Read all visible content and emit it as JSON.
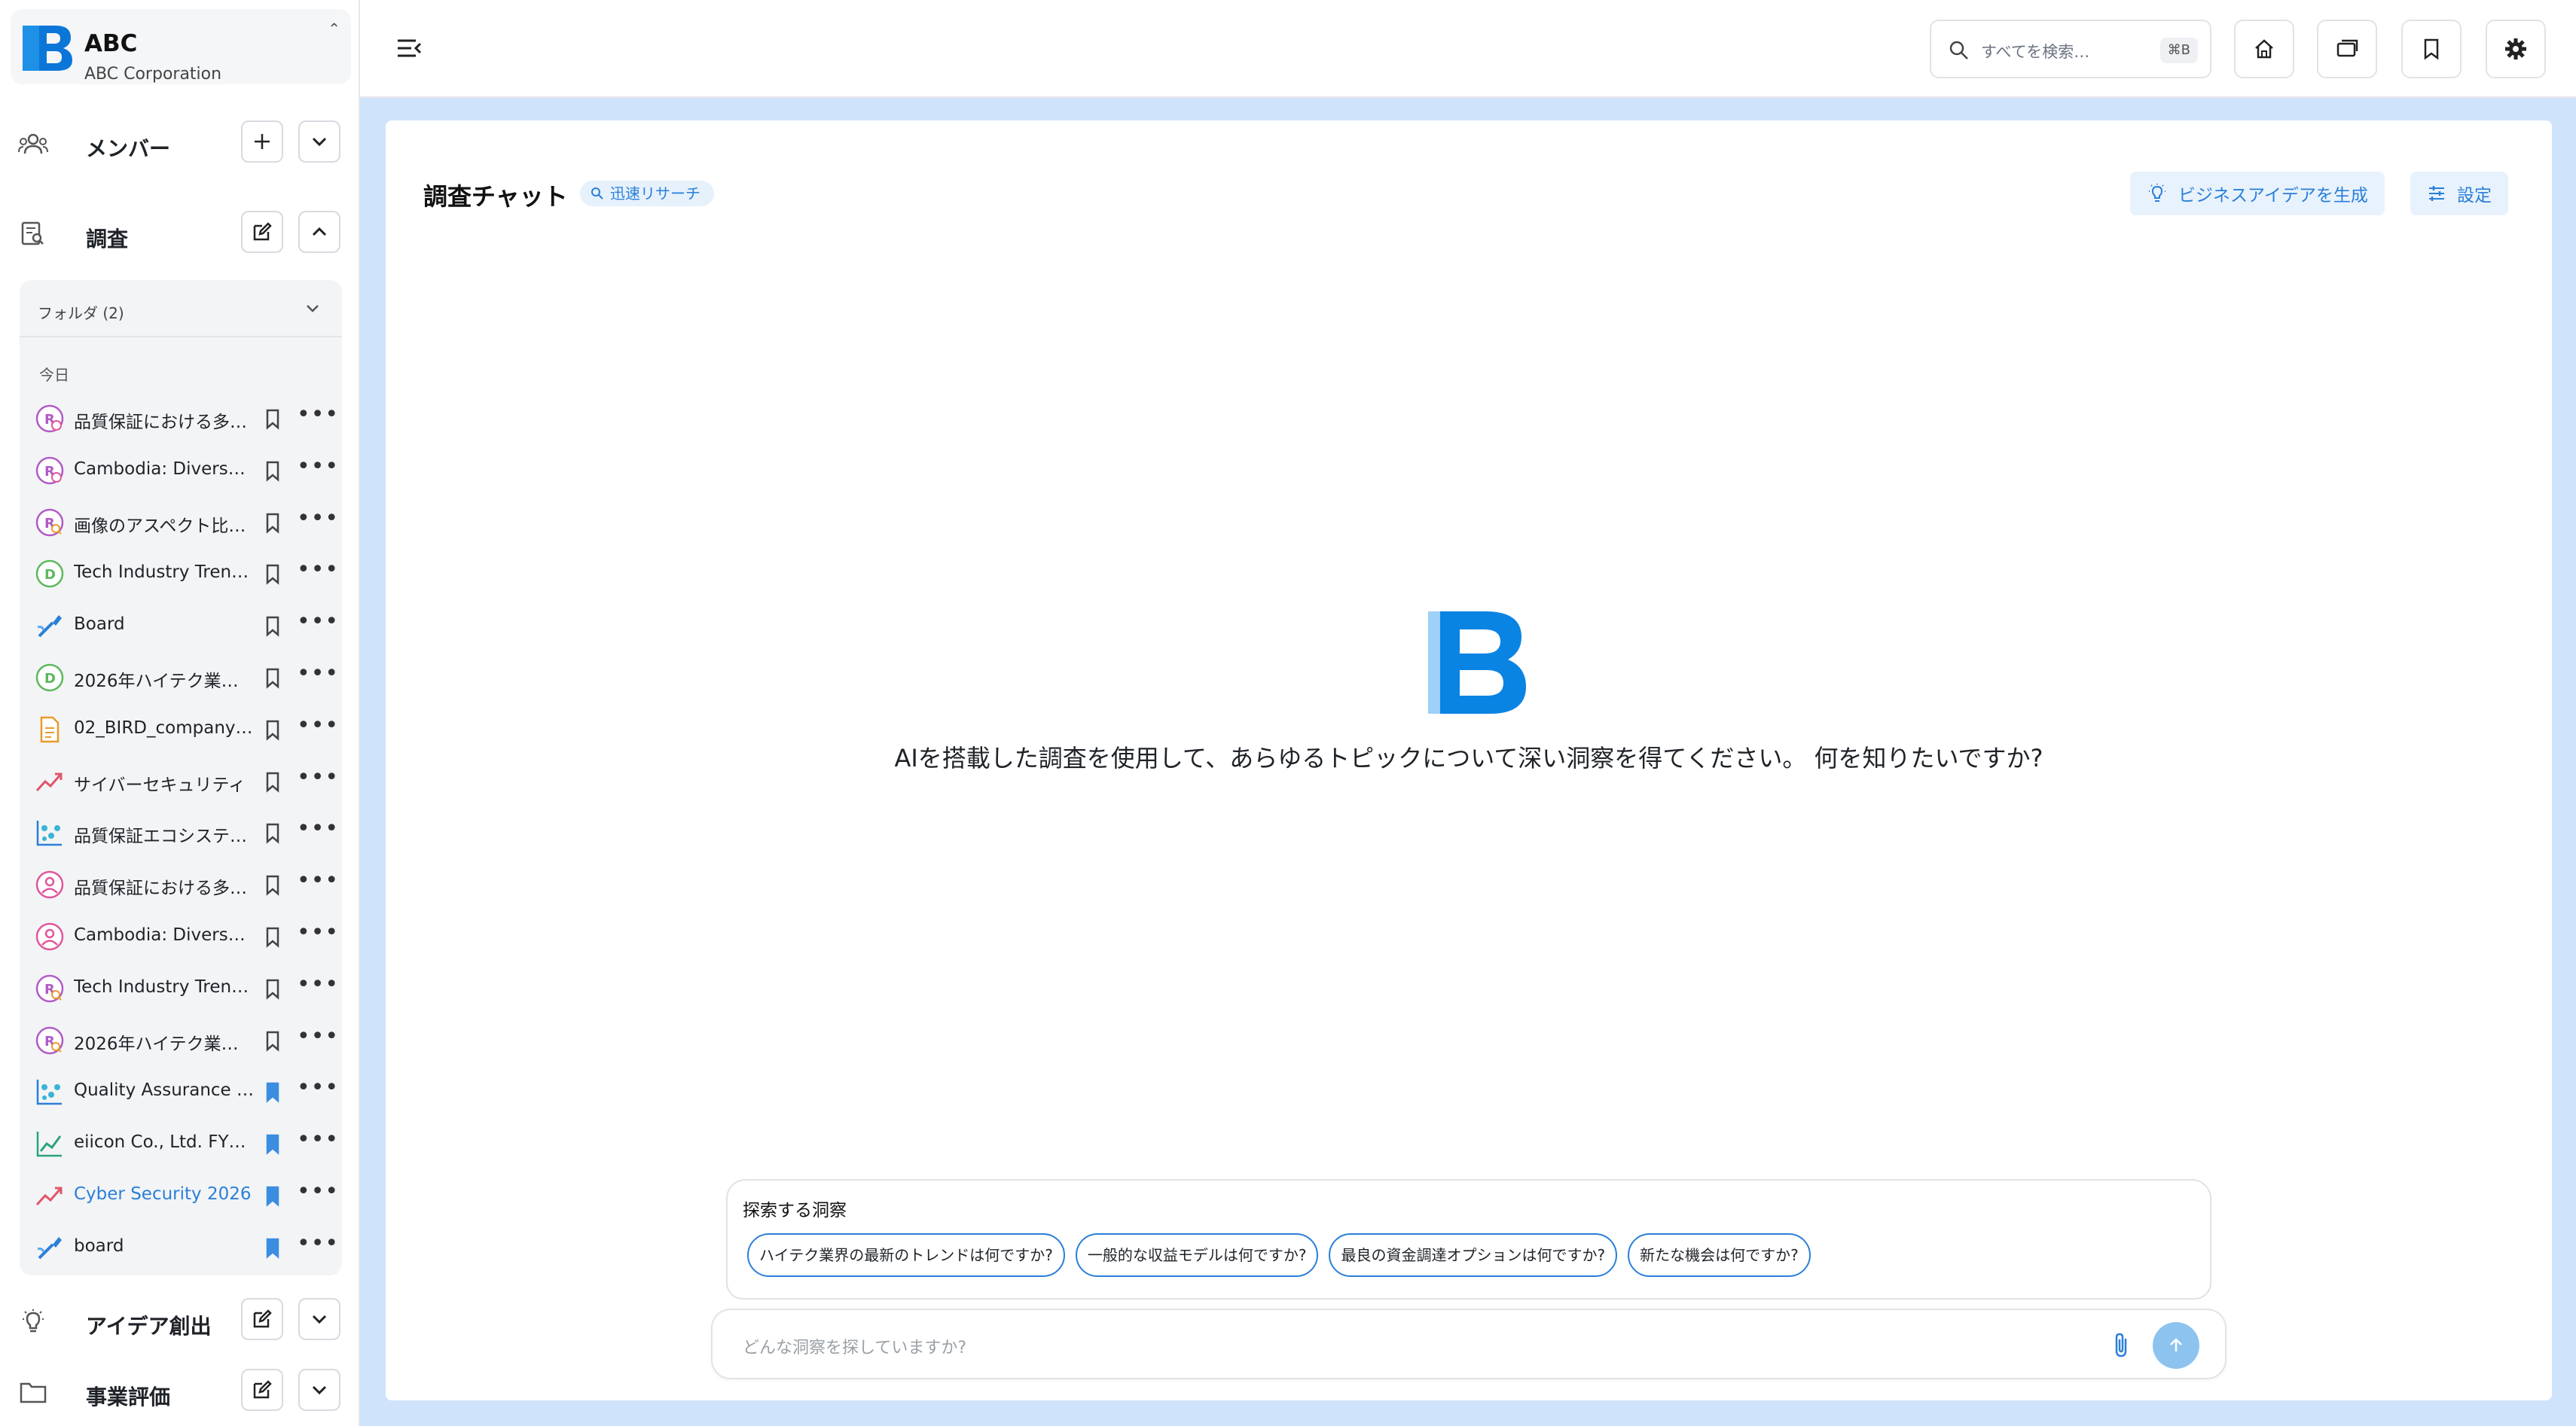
{
  "org": {
    "name": "ABC",
    "subtitle": "ABC Corporation"
  },
  "sections": {
    "members": {
      "label": "メンバー"
    },
    "research": {
      "label": "調査"
    },
    "ideas": {
      "label": "アイデア創出"
    },
    "evaluation": {
      "label": "事業評価"
    }
  },
  "research_list": {
    "folder_label": "フォルダ (2)",
    "group_label": "今日",
    "items": [
      {
        "label": "品質保証における多…",
        "icon": "research-icon",
        "bookmarked": false
      },
      {
        "label": "Cambodia: Diverse …",
        "icon": "research-icon",
        "bookmarked": false
      },
      {
        "label": "画像のアスペクト比…",
        "icon": "research-search-icon",
        "bookmarked": false
      },
      {
        "label": "Tech Industry Trend…",
        "icon": "document-circle-icon",
        "bookmarked": false
      },
      {
        "label": "Board",
        "icon": "board-pen-icon",
        "bookmarked": false
      },
      {
        "label": "2026年ハイテク業…",
        "icon": "document-circle-icon",
        "bookmarked": false
      },
      {
        "label": "02_BIRD_company_…",
        "icon": "file-icon",
        "bookmarked": false
      },
      {
        "label": "サイバーセキュリティ",
        "icon": "trend-icon",
        "bookmarked": false
      },
      {
        "label": "品質保証エコシステ…",
        "icon": "scatter-chart-icon",
        "bookmarked": false
      },
      {
        "label": "品質保証における多…",
        "icon": "person-circle-icon",
        "bookmarked": false
      },
      {
        "label": "Cambodia: Diverse …",
        "icon": "person-circle-icon",
        "bookmarked": false
      },
      {
        "label": "Tech Industry Trend…",
        "icon": "research-search-icon",
        "bookmarked": false
      },
      {
        "label": "2026年ハイテク業…",
        "icon": "research-search-icon",
        "bookmarked": false
      },
      {
        "label": "Quality Assurance …",
        "icon": "scatter-chart-icon",
        "bookmarked": true
      },
      {
        "label": "eiicon Co., Ltd. FY2…",
        "icon": "line-chart-icon",
        "bookmarked": true
      },
      {
        "label": "Cyber Security 2026",
        "icon": "trend-icon",
        "bookmarked": true,
        "active": true
      },
      {
        "label": "board",
        "icon": "board-pen-icon",
        "bookmarked": true
      }
    ]
  },
  "topbar": {
    "search_placeholder": "すべてを検索…",
    "search_shortcut": "⌘B"
  },
  "main": {
    "title": "調査チャット",
    "mode_badge": "迅速リサーチ",
    "generate_button": "ビジネスアイデアを生成",
    "settings_button": "設定",
    "hero_text": "AIを搭載した調査を使用して、あらゆるトピックについて深い洞察を得てください。 何を知りたいですか?",
    "insights_title": "探索する洞察",
    "suggestions": [
      "ハイテク業界の最新のトレンドは何ですか?",
      "一般的な収益モデルは何ですか?",
      "最良の資金調達オプションは何ですか?",
      "新たな機会は何ですか?"
    ],
    "composer_placeholder": "どんな洞察を探していますか?"
  },
  "colors": {
    "accent": "#2a7fd8",
    "background": "#cfe3fb",
    "bookmark_active": "#3b8de0"
  }
}
